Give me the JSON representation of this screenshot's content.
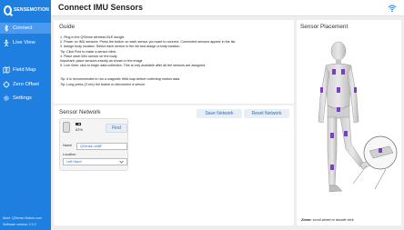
{
  "app": {
    "logo_text": "SENSEMOTION"
  },
  "header": {
    "title": "Connect IMU Sensors"
  },
  "sidebar": {
    "items": [
      {
        "label": "Connect",
        "icon": "bluetooth-icon",
        "active": true
      },
      {
        "label": "Live View",
        "icon": "person-icon",
        "active": false
      },
      {
        "label": "Field Map",
        "icon": "map-icon",
        "active": false
      },
      {
        "label": "Zero Offset",
        "icon": "crosshair-icon",
        "active": false
      },
      {
        "label": "Settings",
        "icon": "gear-icon",
        "active": false
      }
    ],
    "footer_more": "More: QSense-Motion.com",
    "footer_version": "Software version: 2.0.2"
  },
  "guide": {
    "title": "Guide",
    "steps": [
      "1.   Plug in the QSense wireless BLE dongle.",
      "2.   Power on IMU sensors: Press the button on each sensor you want to connect. Connected sensors appear in the list.",
      "3.   Assign body location: Select each sensor in the list and assign a body location.",
      "       Tip: Click Find to make a sensor blink.",
      "4.   Place each IMU sensor on the body.",
      "       Important: place sensors exactly as shown in the image",
      "5.   Live View: click to begin data collection. This is only available after all the sensors are assigned."
    ],
    "tip1": "Tip: It is recommended to run a magnetic field map before collecting motion data.",
    "tip2": "Tip: Long-press (3 sec) the button to disconnect a sensor"
  },
  "network": {
    "title": "Sensor Network",
    "save_label": "Save Network",
    "reset_label": "Reset Network",
    "sensor": {
      "battery": "62%",
      "battery_level": 0.62,
      "find_label": "Find",
      "name_label": "Name",
      "name_value": "QSense-1ABF",
      "location_label": "Location",
      "location_value": "Left Hand"
    }
  },
  "placement": {
    "title": "Sensor Placement",
    "zoom_hint_bold": "Zoom:",
    "zoom_hint": "scroll wheel or double click"
  },
  "colors": {
    "accent": "#1f7fe0",
    "sensor_marker": "#7b3fc4"
  }
}
